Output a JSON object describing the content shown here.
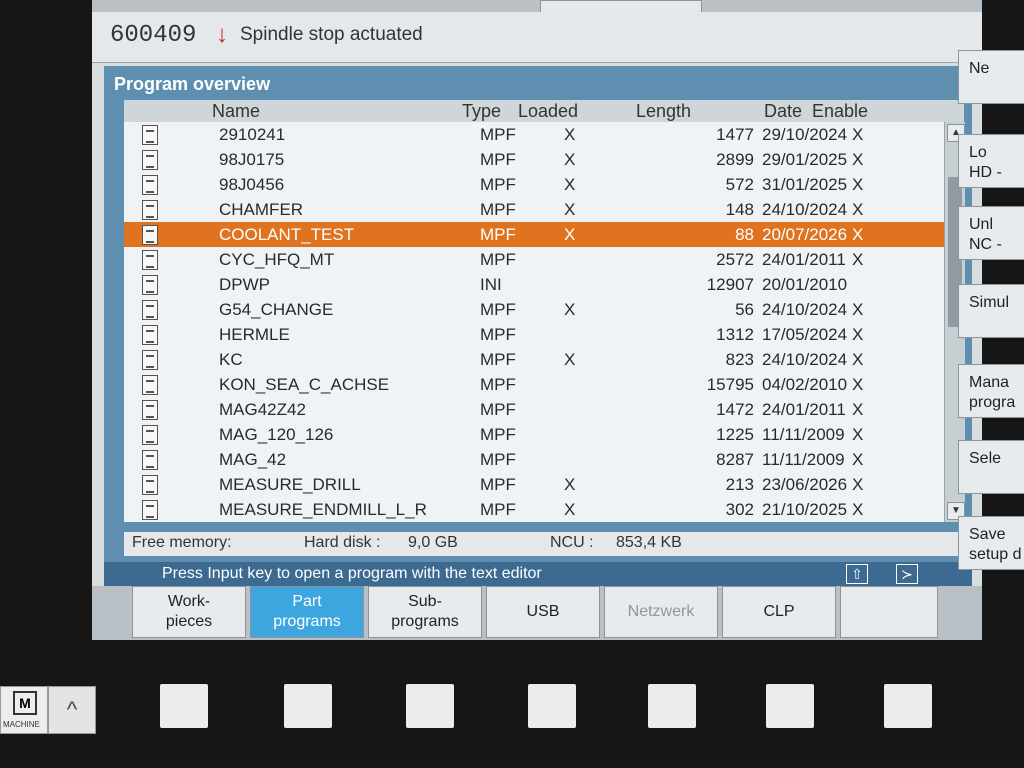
{
  "alarm": {
    "number": "600409",
    "arrow": "↓",
    "message": "Spindle stop actuated"
  },
  "panel": {
    "title": "Program overview"
  },
  "columns": {
    "name": "Name",
    "type": "Type",
    "loaded": "Loaded",
    "length": "Length",
    "date": "Date",
    "enable": "Enable"
  },
  "programs": [
    {
      "name": "2910241",
      "type": "MPF",
      "loaded": "X",
      "length": "1477",
      "date": "29/10/2024",
      "enable": "X"
    },
    {
      "name": "98J0175",
      "type": "MPF",
      "loaded": "X",
      "length": "2899",
      "date": "29/01/2025",
      "enable": "X"
    },
    {
      "name": "98J0456",
      "type": "MPF",
      "loaded": "X",
      "length": "572",
      "date": "31/01/2025",
      "enable": "X"
    },
    {
      "name": "CHAMFER",
      "type": "MPF",
      "loaded": "X",
      "length": "148",
      "date": "24/10/2024",
      "enable": "X"
    },
    {
      "name": "COOLANT_TEST",
      "type": "MPF",
      "loaded": "X",
      "length": "88",
      "date": "20/07/2026",
      "enable": "X"
    },
    {
      "name": "CYC_HFQ_MT",
      "type": "MPF",
      "loaded": "",
      "length": "2572",
      "date": "24/01/2011",
      "enable": "X"
    },
    {
      "name": "DPWP",
      "type": "INI",
      "loaded": "",
      "length": "12907",
      "date": "20/01/2010",
      "enable": ""
    },
    {
      "name": "G54_CHANGE",
      "type": "MPF",
      "loaded": "X",
      "length": "56",
      "date": "24/10/2024",
      "enable": "X"
    },
    {
      "name": "HERMLE",
      "type": "MPF",
      "loaded": "",
      "length": "1312",
      "date": "17/05/2024",
      "enable": "X"
    },
    {
      "name": "KC",
      "type": "MPF",
      "loaded": "X",
      "length": "823",
      "date": "24/10/2024",
      "enable": "X"
    },
    {
      "name": "KON_SEA_C_ACHSE",
      "type": "MPF",
      "loaded": "",
      "length": "15795",
      "date": "04/02/2010",
      "enable": "X"
    },
    {
      "name": "MAG42Z42",
      "type": "MPF",
      "loaded": "",
      "length": "1472",
      "date": "24/01/2011",
      "enable": "X"
    },
    {
      "name": "MAG_120_126",
      "type": "MPF",
      "loaded": "",
      "length": "1225",
      "date": "11/11/2009",
      "enable": "X"
    },
    {
      "name": "MAG_42",
      "type": "MPF",
      "loaded": "",
      "length": "8287",
      "date": "11/11/2009",
      "enable": "X"
    },
    {
      "name": "MEASURE_DRILL",
      "type": "MPF",
      "loaded": "X",
      "length": "213",
      "date": "23/06/2026",
      "enable": "X"
    },
    {
      "name": "MEASURE_ENDMILL_L_R",
      "type": "MPF",
      "loaded": "X",
      "length": "302",
      "date": "21/10/2025",
      "enable": "X"
    }
  ],
  "selected_index": 4,
  "memory": {
    "label": "Free memory:",
    "hd_label": "Hard disk :",
    "hd_value": "9,0 GB",
    "ncu_label": "NCU :",
    "ncu_value": "853,4 KB"
  },
  "status": {
    "text": "Press Input key to open a program with the text editor",
    "up_icon": "⇧",
    "next_icon": "≻"
  },
  "softkeys": [
    {
      "line1": "Work-",
      "line2": "pieces",
      "state": "normal"
    },
    {
      "line1": "Part",
      "line2": "programs",
      "state": "active"
    },
    {
      "line1": "Sub-",
      "line2": "programs",
      "state": "normal"
    },
    {
      "line1": "USB",
      "line2": "",
      "state": "normal"
    },
    {
      "line1": "Netzwerk",
      "line2": "",
      "state": "disabled"
    },
    {
      "line1": "CLP",
      "line2": "",
      "state": "normal"
    },
    {
      "line1": "",
      "line2": "",
      "state": "normal"
    }
  ],
  "right_softkeys": [
    {
      "line1": "Ne",
      "line2": ""
    },
    {
      "line1": "Lo",
      "line2": "HD -"
    },
    {
      "line1": "Unl",
      "line2": "NC -"
    },
    {
      "line1": "Simul",
      "line2": ""
    },
    {
      "line1": "Mana",
      "line2": "progra"
    },
    {
      "line1": "Sele",
      "line2": ""
    },
    {
      "line1": "Save",
      "line2": "setup d"
    }
  ],
  "machine_button": {
    "symbol": "M",
    "label": "MACHINE"
  },
  "up_button": {
    "symbol": "^"
  }
}
